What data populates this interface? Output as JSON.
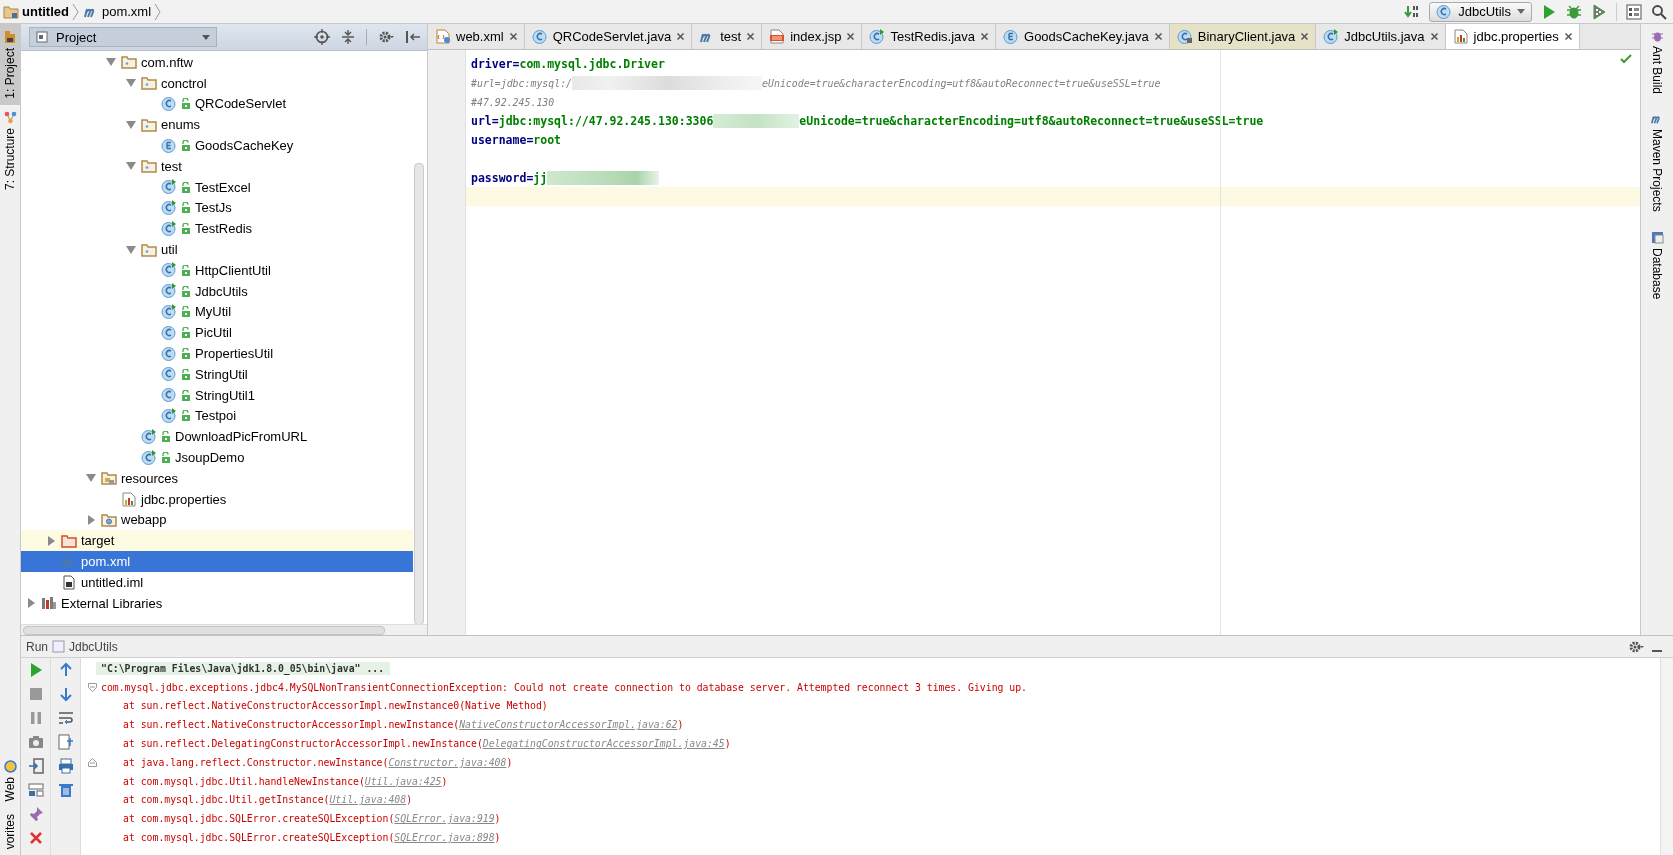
{
  "breadcrumb": [
    {
      "kind": "module",
      "label": "untitled"
    },
    {
      "kind": "maven",
      "label": "pom.xml"
    }
  ],
  "run_config": {
    "label": "JdbcUtils"
  },
  "left_stripe": [
    {
      "kind": "project",
      "label": "1: Project",
      "selected": true
    },
    {
      "kind": "structure",
      "label": "7: Structure",
      "selected": false
    },
    {
      "kind": "web",
      "label": "Web",
      "selected": false
    },
    {
      "kind": "favorites",
      "label": "vorites",
      "selected": false
    }
  ],
  "right_stripe": [
    {
      "kind": "ant",
      "label": "Ant Build"
    },
    {
      "kind": "maven",
      "label": "Maven Projects"
    },
    {
      "kind": "database",
      "label": "Database"
    }
  ],
  "project_panel": {
    "title": "Project",
    "tree": [
      {
        "children": [
          {
            "children": [
              {
                "children": [
                  {
                    "children": [
                      {
                        "kind": "package",
                        "label": "com.nftw",
                        "expanded": true,
                        "selected": false,
                        "children": [
                          {
                            "kind": "package",
                            "label": "conctrol",
                            "expanded": true,
                            "selected": false,
                            "children": [
                              {
                                "kind": "class",
                                "label": "QRCodeServlet",
                                "selected": false
                              }
                            ]
                          },
                          {
                            "kind": "package",
                            "label": "enums",
                            "expanded": true,
                            "selected": false,
                            "children": [
                              {
                                "kind": "enum",
                                "label": "GoodsCacheKey",
                                "selected": false
                              }
                            ]
                          },
                          {
                            "kind": "package",
                            "label": "test",
                            "expanded": true,
                            "selected": false,
                            "children": [
                              {
                                "kind": "runnable",
                                "label": "TestExcel",
                                "selected": false
                              },
                              {
                                "kind": "runnable",
                                "label": "TestJs",
                                "selected": false
                              },
                              {
                                "kind": "runnable",
                                "label": "TestRedis",
                                "selected": false
                              }
                            ]
                          },
                          {
                            "kind": "package",
                            "label": "util",
                            "expanded": true,
                            "selected": false,
                            "children": [
                              {
                                "kind": "runnable",
                                "label": "HttpClientUtil",
                                "selected": false
                              },
                              {
                                "kind": "runnable",
                                "label": "JdbcUtils",
                                "selected": false
                              },
                              {
                                "kind": "runnable",
                                "label": "MyUtil",
                                "selected": false
                              },
                              {
                                "kind": "class",
                                "label": "PicUtil",
                                "selected": false
                              },
                              {
                                "kind": "class",
                                "label": "PropertiesUtil",
                                "selected": false
                              },
                              {
                                "kind": "class",
                                "label": "StringUtil",
                                "selected": false
                              },
                              {
                                "kind": "class",
                                "label": "StringUtil1",
                                "selected": false
                              },
                              {
                                "kind": "runnable",
                                "label": "Testpoi",
                                "selected": false
                              }
                            ]
                          },
                          {
                            "kind": "runnable",
                            "label": "DownloadPicFromURL",
                            "selected": false
                          },
                          {
                            "kind": "runnable",
                            "label": "JsoupDemo",
                            "selected": false
                          }
                        ]
                      }
                    ]
                  },
                  {
                    "kind": "resources",
                    "label": "resources",
                    "expanded": true,
                    "selected": false,
                    "children": [
                      {
                        "kind": "properties",
                        "label": "jdbc.properties",
                        "selected": false
                      }
                    ]
                  },
                  {
                    "kind": "webfolder",
                    "label": "webapp",
                    "expanded": false,
                    "selected": false
                  }
                ]
              }
            ]
          },
          {
            "kind": "excluded",
            "label": "target",
            "expanded": false,
            "selected": false
          },
          {
            "kind": "maven",
            "label": "pom.xml",
            "selected": true
          },
          {
            "kind": "module",
            "label": "untitled.iml",
            "selected": false
          }
        ]
      },
      {
        "kind": "libraries",
        "label": "External Libraries",
        "expanded": false,
        "selected": false
      }
    ]
  },
  "tabs": [
    {
      "kind": "xml",
      "label": "web.xml",
      "selected": false
    },
    {
      "kind": "class",
      "label": "QRCodeServlet.java",
      "selected": false
    },
    {
      "kind": "maven",
      "label": "test",
      "selected": false
    },
    {
      "kind": "jsp",
      "label": "index.jsp",
      "selected": false
    },
    {
      "kind": "runnable",
      "label": "TestRedis.java",
      "selected": false
    },
    {
      "kind": "enum",
      "label": "GoodsCacheKey.java",
      "selected": false
    },
    {
      "kind": "library",
      "label": "BinaryClient.java",
      "selected": false
    },
    {
      "kind": "runnable",
      "label": "JdbcUtils.java",
      "selected": false
    },
    {
      "kind": "properties",
      "label": "jdbc.properties",
      "selected": true
    }
  ],
  "editor": {
    "lines": [
      {
        "current": false,
        "parts": [
          {
            "kind": "key",
            "text": "driver"
          },
          {
            "kind": "sign",
            "text": "="
          },
          {
            "kind": "value",
            "text": "com.mysql.jdbc.Driver"
          }
        ]
      },
      {
        "current": false,
        "parts": [
          {
            "kind": "comment",
            "text": "#url=jdbc:mysql:/"
          },
          {
            "kind": "redacted"
          },
          {
            "kind": "comment",
            "text": "eUnicode=true&characterEncoding=utf8&autoReconnect=true&useSSL=true"
          }
        ]
      },
      {
        "current": false,
        "parts": [
          {
            "kind": "comment",
            "text": "#47.92.245.130"
          }
        ]
      },
      {
        "current": false,
        "parts": [
          {
            "kind": "key",
            "text": "url"
          },
          {
            "kind": "sign",
            "text": "="
          },
          {
            "kind": "value",
            "text": "jdbc:mysql://47.92.245.130:3306"
          },
          {
            "kind": "redacted"
          },
          {
            "kind": "value",
            "text": "eUnicode=true&characterEncoding=utf8&autoReconnect=true&useSSL=true"
          }
        ]
      },
      {
        "current": false,
        "parts": [
          {
            "kind": "key",
            "text": "username"
          },
          {
            "kind": "sign",
            "text": "="
          },
          {
            "kind": "value",
            "text": "root"
          }
        ]
      },
      {
        "current": false
      },
      {
        "current": false,
        "parts": [
          {
            "kind": "key",
            "text": "password"
          },
          {
            "kind": "sign",
            "text": "="
          },
          {
            "kind": "value",
            "text": "jj"
          },
          {
            "kind": "redacted"
          }
        ]
      },
      {
        "current": true
      }
    ]
  },
  "run_panel": {
    "title": "Run",
    "config": "JdbcUtils",
    "lines": [
      {
        "kind": "command",
        "text": "\"C:\\Program Files\\Java\\jdk1.8.0_05\\bin\\java\" ..."
      },
      {
        "kind": "error",
        "text": "com.mysql.jdbc.exceptions.jdbc4.MySQLNonTransientConnectionException: Could not create connection to database server. Attempted reconnect 3 times. Giving up.",
        "folded": false
      },
      {
        "kind": "frame",
        "text": "at sun.reflect.NativeConstructorAccessorImpl.newInstance0(Native Method)"
      },
      {
        "kind": "frame",
        "text": "at sun.reflect.NativeConstructorAccessorImpl.newInstance(",
        "link": "NativeConstructorAccessorImpl.java:62",
        "after": ")"
      },
      {
        "kind": "frame",
        "text": "at sun.reflect.DelegatingConstructorAccessorImpl.newInstance(",
        "link": "DelegatingConstructorAccessorImpl.java:45",
        "after": ")"
      },
      {
        "kind": "frame",
        "text": "at java.lang.reflect.Constructor.newInstance(",
        "link": "Constructor.java:408",
        "after": ")",
        "fold_end": true
      },
      {
        "kind": "frame",
        "text": "at com.mysql.jdbc.Util.handleNewInstance(",
        "link": "Util.java:425",
        "after": ")"
      },
      {
        "kind": "frame",
        "text": "at com.mysql.jdbc.Util.getInstance(",
        "link": "Util.java:408",
        "after": ")"
      },
      {
        "kind": "frame",
        "text": "at com.mysql.jdbc.SQLError.createSQLException(",
        "link": "SQLError.java:919",
        "after": ")"
      },
      {
        "kind": "frame",
        "text": "at com.mysql.jdbc.SQLError.createSQLException(",
        "link": "SQLError.java:898",
        "after": ")"
      }
    ]
  }
}
